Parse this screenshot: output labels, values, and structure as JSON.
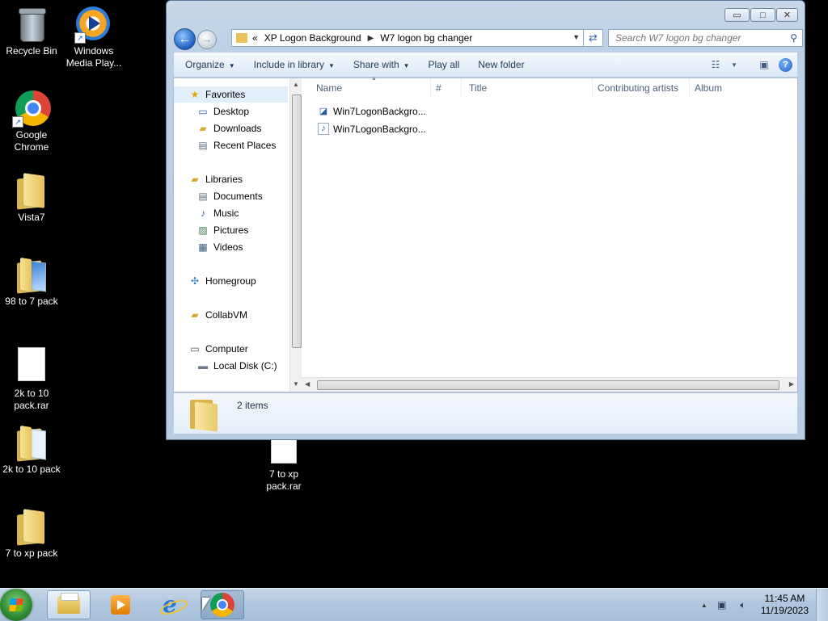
{
  "desktop": {
    "icons": [
      {
        "label": "Recycle Bin",
        "icon": "recycle-bin-icon"
      },
      {
        "label": "Windows Media Play...",
        "icon": "windows-media-player-icon"
      },
      {
        "label": "Google Chrome",
        "icon": "chrome-icon"
      },
      {
        "label": "Vista7",
        "icon": "folder-icon"
      },
      {
        "label": "98 to 7 pack",
        "icon": "folder-icon"
      },
      {
        "label": "2k to 10 pack.rar",
        "icon": "rar-file-icon"
      },
      {
        "label": "2k to 10 pack",
        "icon": "folder-icon"
      },
      {
        "label": "7 to xp pack.rar",
        "icon": "rar-file-icon"
      },
      {
        "label": "7 to xp pack",
        "icon": "folder-icon"
      }
    ]
  },
  "window": {
    "controls": {
      "minimize": "▭",
      "maximize": "□",
      "close": "✕"
    },
    "address": {
      "overflow": "«",
      "crumbs": [
        "XP Logon Background",
        "W7 logon bg changer"
      ]
    },
    "search": {
      "placeholder": "Search W7 logon bg changer"
    },
    "toolbar": {
      "organize": "Organize",
      "include_in_library": "Include in library",
      "share_with": "Share with",
      "play_all": "Play all",
      "new_folder": "New folder"
    },
    "nav": {
      "favorites": "Favorites",
      "desktop": "Desktop",
      "downloads": "Downloads",
      "recent_places": "Recent Places",
      "libraries": "Libraries",
      "documents": "Documents",
      "music": "Music",
      "pictures": "Pictures",
      "videos": "Videos",
      "homegroup": "Homegroup",
      "collabvm": "CollabVM",
      "computer": "Computer",
      "local_disk": "Local Disk (C:)"
    },
    "columns": {
      "name": "Name",
      "number": "#",
      "title": "Title",
      "contributing_artists": "Contributing artists",
      "album": "Album"
    },
    "files": [
      {
        "name": "Win7LogonBackgro...",
        "icon": "application-icon"
      },
      {
        "name": "Win7LogonBackgro...",
        "icon": "audio-file-icon"
      }
    ],
    "details": {
      "item_count": "2 items"
    }
  },
  "taskbar": {
    "clock": {
      "time": "11:45 AM",
      "date": "11/19/2023"
    },
    "pinned": [
      "windows-explorer-icon",
      "windows-media-player-icon",
      "internet-explorer-icon",
      "chrome-icon"
    ]
  }
}
